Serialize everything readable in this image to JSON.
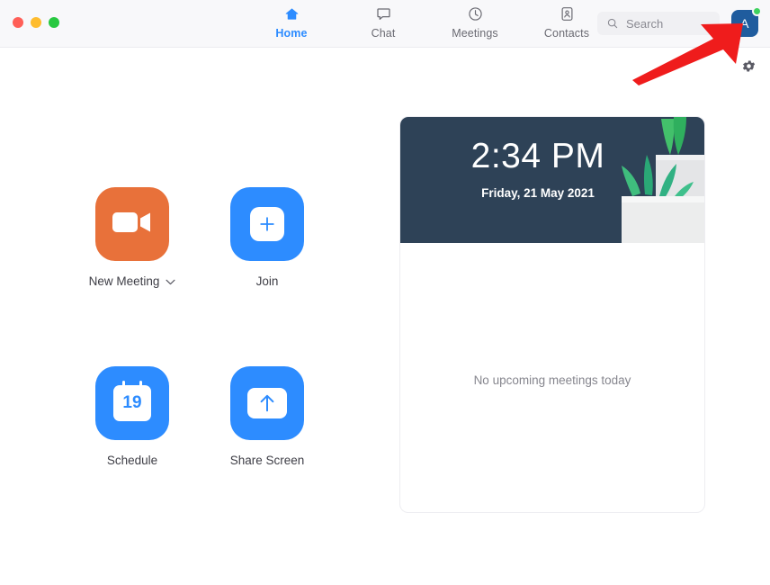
{
  "window": {
    "traffic_lights": [
      {
        "name": "close",
        "color": "#ff5f57"
      },
      {
        "name": "minimize",
        "color": "#febc2e"
      },
      {
        "name": "zoom",
        "color": "#28c840"
      }
    ]
  },
  "nav": {
    "tabs": [
      {
        "label": "Home",
        "icon": "home-icon",
        "active": true
      },
      {
        "label": "Chat",
        "icon": "chat-bubble-icon",
        "active": false
      },
      {
        "label": "Meetings",
        "icon": "clock-icon",
        "active": false
      },
      {
        "label": "Contacts",
        "icon": "contact-card-icon",
        "active": false
      }
    ],
    "active_color": "#2d8cff",
    "inactive_color": "#6a6a72"
  },
  "search": {
    "placeholder": "Search",
    "icon": "search-icon"
  },
  "account": {
    "avatar_initial": "A",
    "avatar_color": "#1f5c9e",
    "presence": "available",
    "presence_color": "#3fd25f"
  },
  "settings": {
    "icon": "gear-icon",
    "label": "Settings"
  },
  "actions": [
    {
      "label": "New Meeting",
      "icon": "video-camera-icon",
      "tile_color": "#e8713a",
      "has_dropdown": true,
      "dropdown_icon": "chevron-down-icon"
    },
    {
      "label": "Join",
      "icon": "plus-icon",
      "tile_color": "#2d8cff",
      "has_dropdown": false
    },
    {
      "label": "Schedule",
      "icon": "calendar-icon",
      "tile_color": "#2d8cff",
      "calendar_day": "19",
      "has_dropdown": false
    },
    {
      "label": "Share Screen",
      "icon": "share-screen-arrow-icon",
      "tile_color": "#2d8cff",
      "has_dropdown": false
    }
  ],
  "meetings_panel": {
    "time": "2:34 PM",
    "date": "Friday, 21 May 2021",
    "banner_color": "#2e4257",
    "empty_message": "No upcoming meetings today",
    "illustration": "potted-plants-illustration"
  },
  "annotation": {
    "type": "arrow",
    "color": "#ef1c1c",
    "points_to": "profile-avatar"
  }
}
